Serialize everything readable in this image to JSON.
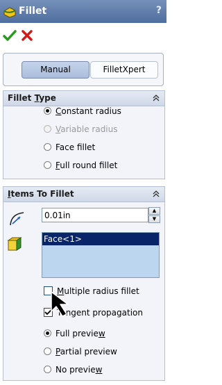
{
  "title": "Fillet",
  "help_label": "?",
  "icons": {
    "title": "fillet-feature-icon",
    "ok": "green-check-icon",
    "cancel": "red-x-icon",
    "collapse": "double-chevron-up-icon",
    "radius": "radius-arc-icon",
    "face": "face-selection-icon",
    "cursor": "arrow-cursor-icon"
  },
  "colors": {
    "title_bar": "#5a77a8",
    "selection": "#0a246a",
    "list_bg": "#bdd6f0"
  },
  "mode_tabs": {
    "manual": "Manual",
    "filletxpert": "FilletXpert",
    "selected": "Manual"
  },
  "fillet_type": {
    "header_pre": "Fillet ",
    "header_ul": "T",
    "header_post": "ype",
    "options": {
      "constant": {
        "ul": "C",
        "rest": "onstant radius",
        "checked": true,
        "enabled": true
      },
      "variable": {
        "ul": "V",
        "rest": "ariable radius",
        "checked": false,
        "enabled": false
      },
      "face": {
        "text": "Face fillet",
        "checked": false,
        "enabled": true
      },
      "fullround": {
        "ul": "F",
        "rest": "ull round fillet",
        "checked": false,
        "enabled": true
      }
    }
  },
  "items_to_fillet": {
    "header_ul": "I",
    "header_rest": "tems To Fillet",
    "radius_value": "0.01in",
    "face_list": [
      "Face<1>"
    ],
    "multiple_radius": {
      "ul": "M",
      "rest": "ultiple radius fillet",
      "checked": false
    },
    "tangent": {
      "text": "Tangent propagation",
      "checked": true
    },
    "preview": {
      "full": {
        "pre": "Full previe",
        "ul": "w",
        "checked": true
      },
      "partial": {
        "ul": "P",
        "rest": "artial preview",
        "checked": false
      },
      "none": {
        "pre": "No previe",
        "ul": "w",
        "checked": false
      }
    }
  }
}
